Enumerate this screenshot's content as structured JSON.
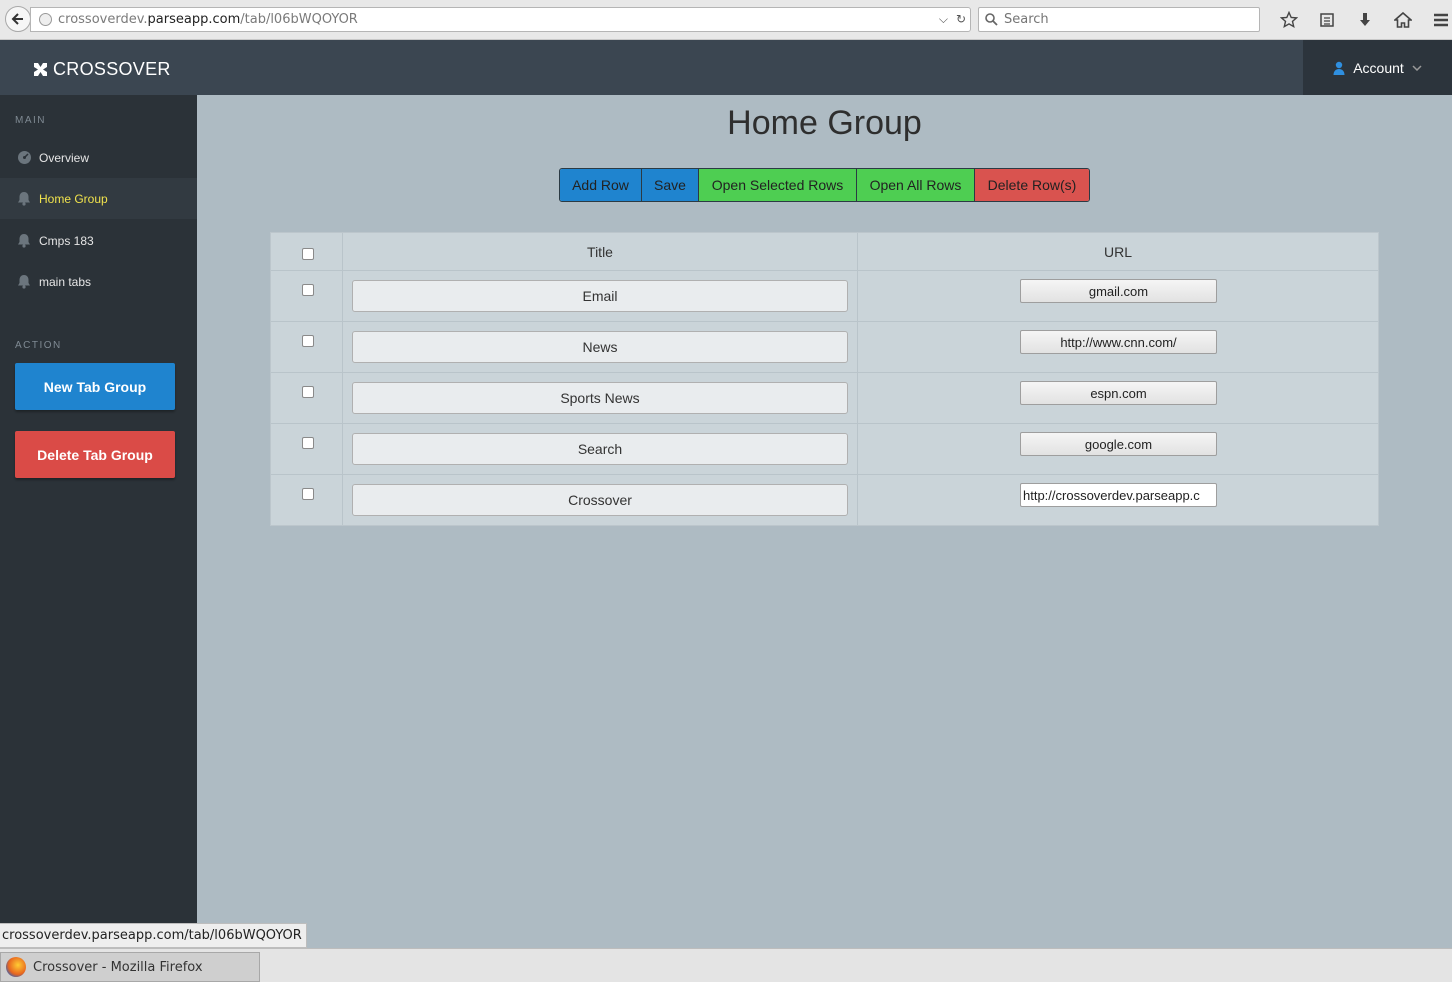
{
  "browser": {
    "url_prefix": "crossoverdev.",
    "url_domain": "parseapp.com",
    "url_path": "/tab/l06bWQOYOR",
    "search_placeholder": "Search"
  },
  "header": {
    "brand": "CROSSOVER",
    "account_label": "Account"
  },
  "sidebar": {
    "main_heading": "MAIN",
    "items": [
      {
        "label": "Overview",
        "icon": "dashboard-icon"
      },
      {
        "label": "Home Group",
        "icon": "bell-icon",
        "active": true
      },
      {
        "label": "Cmps 183",
        "icon": "bell-icon"
      },
      {
        "label": "main tabs",
        "icon": "bell-icon"
      }
    ],
    "action_heading": "ACTION",
    "new_button": "New Tab Group",
    "delete_button": "Delete Tab Group"
  },
  "main": {
    "title": "Home Group",
    "buttons": {
      "add_row": "Add Row",
      "save": "Save",
      "open_selected": "Open Selected Rows",
      "open_all": "Open All Rows",
      "delete_rows": "Delete Row(s)"
    },
    "table": {
      "headers": {
        "title": "Title",
        "url": "URL"
      },
      "rows": [
        {
          "title": "Email",
          "url": "gmail.com"
        },
        {
          "title": "News",
          "url": "http://www.cnn.com/"
        },
        {
          "title": "Sports News",
          "url": "espn.com"
        },
        {
          "title": "Search",
          "url": "google.com"
        },
        {
          "title": "Crossover",
          "url": "http://crossoverdev.parseapp.c"
        }
      ]
    }
  },
  "status_bar": {
    "text": "crossoverdev.parseapp.com/tab/l06bWQOYOR"
  },
  "taskbar": {
    "window_title": "Crossover - Mozilla Firefox"
  },
  "colors": {
    "header_bg": "#3b4651",
    "sidebar_bg": "#2b3238",
    "content_bg": "#aebbc3",
    "active_item": "#f0e24c",
    "blue": "#1f84cf",
    "green": "#4ece52",
    "red": "#d9534f"
  }
}
